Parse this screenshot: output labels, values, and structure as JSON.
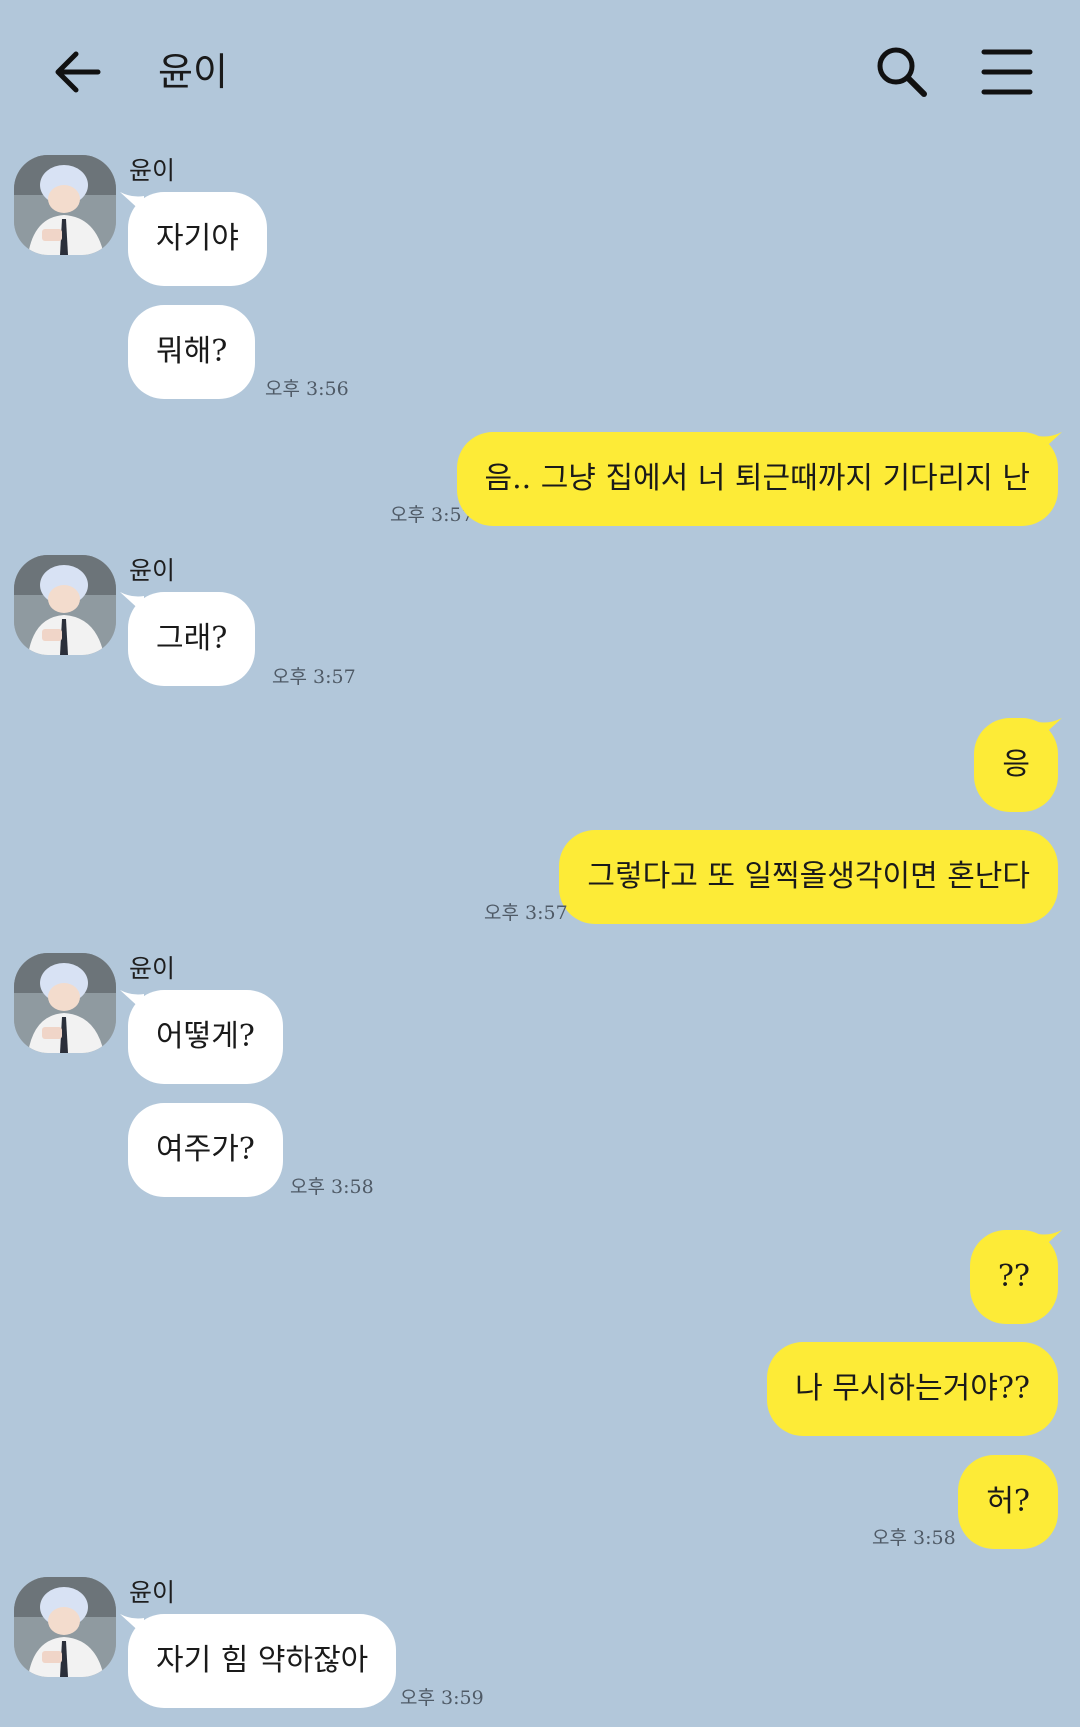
{
  "header": {
    "title": "윤이"
  },
  "sender_name": "윤이",
  "messages": {
    "m1": "자기야",
    "m2": "뭐해?",
    "m3": "음.. 그냥 집에서 너 퇴근때까지 기다리지 난",
    "m4": "그래?",
    "m5": "응",
    "m6": "그렇다고 또 일찍올생각이면 혼난다",
    "m7": "어떻게?",
    "m8": "여주가?",
    "m9": "??",
    "m10": "나 무시하는거야??",
    "m11": "허?",
    "m12": "자기 힘 약하잖아"
  },
  "times": {
    "t1": "오후 3:56",
    "t2": "오후 3:57",
    "t3": "오후 3:57",
    "t4": "오후 3:57",
    "t5": "오후 3:58",
    "t6": "오후 3:58",
    "t7": "오후 3:59"
  },
  "colors": {
    "background": "#b2c7da",
    "received_bubble": "#ffffff",
    "sent_bubble": "#fdeb37"
  },
  "icons": [
    "back-arrow-icon",
    "search-icon",
    "menu-icon"
  ]
}
